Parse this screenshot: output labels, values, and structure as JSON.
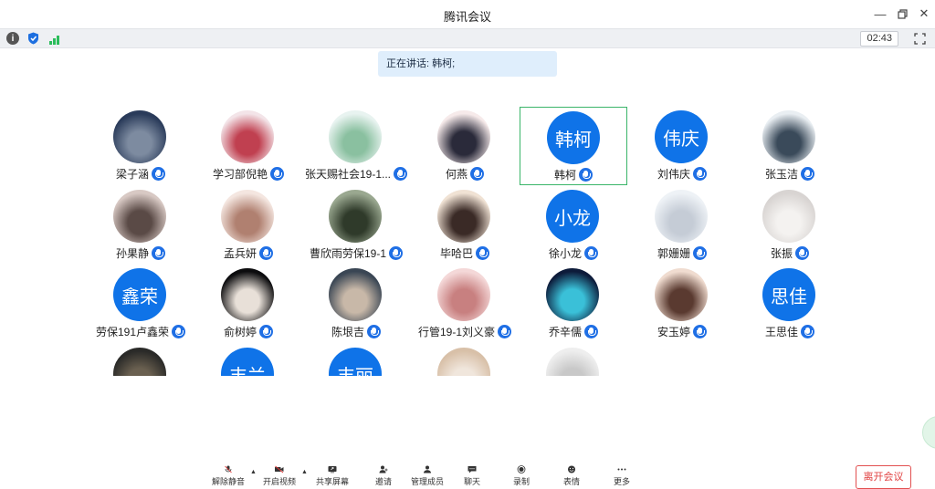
{
  "window": {
    "title": "腾讯会议"
  },
  "status": {
    "timer": "02:43"
  },
  "speaking": {
    "text": "正在讲话: 韩柯;"
  },
  "participants": [
    {
      "name": "梁子涵",
      "avatar_type": "photo",
      "colors": [
        "#2a3b5a",
        "#7d8ba0"
      ]
    },
    {
      "name": "学习部倪艳",
      "avatar_type": "photo",
      "colors": [
        "#f3e4e8",
        "#c04050"
      ]
    },
    {
      "name": "张天赐社会19-1...",
      "avatar_type": "photo",
      "colors": [
        "#e8f3f0",
        "#8ac0a0"
      ]
    },
    {
      "name": "何燕",
      "avatar_type": "photo",
      "colors": [
        "#f6eaea",
        "#2a2a3a"
      ]
    },
    {
      "name": "韩柯",
      "avatar_type": "text",
      "avatar_text": "韩柯",
      "active": true
    },
    {
      "name": "刘伟庆",
      "avatar_type": "text",
      "avatar_text": "伟庆"
    },
    {
      "name": "张玉洁",
      "avatar_type": "photo",
      "colors": [
        "#e9eef2",
        "#3a4a5a"
      ]
    },
    {
      "name": "孙果静",
      "avatar_type": "photo",
      "colors": [
        "#d8c9c4",
        "#5a4a46"
      ]
    },
    {
      "name": "孟兵妍",
      "avatar_type": "photo",
      "colors": [
        "#f4e6e0",
        "#b08070"
      ]
    },
    {
      "name": "曹欣雨劳保19-1",
      "avatar_type": "photo",
      "colors": [
        "#9aa890",
        "#2f3a2a"
      ]
    },
    {
      "name": "毕哈巴",
      "avatar_type": "photo",
      "colors": [
        "#f0e2d4",
        "#3a2a26"
      ]
    },
    {
      "name": "徐小龙",
      "avatar_type": "text",
      "avatar_text": "小龙"
    },
    {
      "name": "郭姗姗",
      "avatar_type": "photo",
      "colors": [
        "#eef2f6",
        "#c5ccd6"
      ]
    },
    {
      "name": "张振",
      "avatar_type": "photo",
      "colors": [
        "#d8d4d2",
        "#f4f2f0"
      ]
    },
    {
      "name": "劳保191卢鑫荣",
      "avatar_type": "text",
      "avatar_text": "鑫荣"
    },
    {
      "name": "俞树婷",
      "avatar_type": "photo",
      "colors": [
        "#0c0c0e",
        "#e8e0d8"
      ]
    },
    {
      "name": "陈垠吉",
      "avatar_type": "photo",
      "colors": [
        "#3a4654",
        "#c8b8a8"
      ]
    },
    {
      "name": "行管19-1刘义豪",
      "avatar_type": "photo",
      "colors": [
        "#f4d8d8",
        "#c88080"
      ]
    },
    {
      "name": "乔辛儒",
      "avatar_type": "photo",
      "colors": [
        "#0d1b3a",
        "#3ac0d8"
      ]
    },
    {
      "name": "安玉婷",
      "avatar_type": "photo",
      "colors": [
        "#f0dcd0",
        "#5a3a30"
      ]
    },
    {
      "name": "王思佳",
      "avatar_type": "text",
      "avatar_text": "思佳"
    },
    {
      "name": "",
      "avatar_type": "photo",
      "colors": [
        "#2a2a28",
        "#6a6050"
      ]
    },
    {
      "name": "",
      "avatar_type": "text",
      "avatar_text": "丰兰"
    },
    {
      "name": "",
      "avatar_type": "text",
      "avatar_text": "丰丽"
    },
    {
      "name": "",
      "avatar_type": "photo",
      "colors": [
        "#d8c0a8",
        "#f0e6dc"
      ]
    },
    {
      "name": "",
      "avatar_type": "photo",
      "colors": [
        "#eeeeee",
        "#c8c8c8"
      ]
    }
  ],
  "toolbar": {
    "buttons": [
      {
        "label": "解除静音",
        "icon": "mic-off-icon"
      },
      {
        "label": "开启视频",
        "icon": "video-off-icon"
      },
      {
        "label": "共享屏幕",
        "icon": "share-screen-icon"
      },
      {
        "label": "邀请",
        "icon": "invite-icon"
      },
      {
        "label": "管理成员",
        "icon": "members-icon"
      },
      {
        "label": "聊天",
        "icon": "chat-icon"
      },
      {
        "label": "录制",
        "icon": "record-icon"
      },
      {
        "label": "表情",
        "icon": "emoji-icon"
      },
      {
        "label": "更多",
        "icon": "more-icon"
      }
    ],
    "leave_label": "离开会议"
  }
}
